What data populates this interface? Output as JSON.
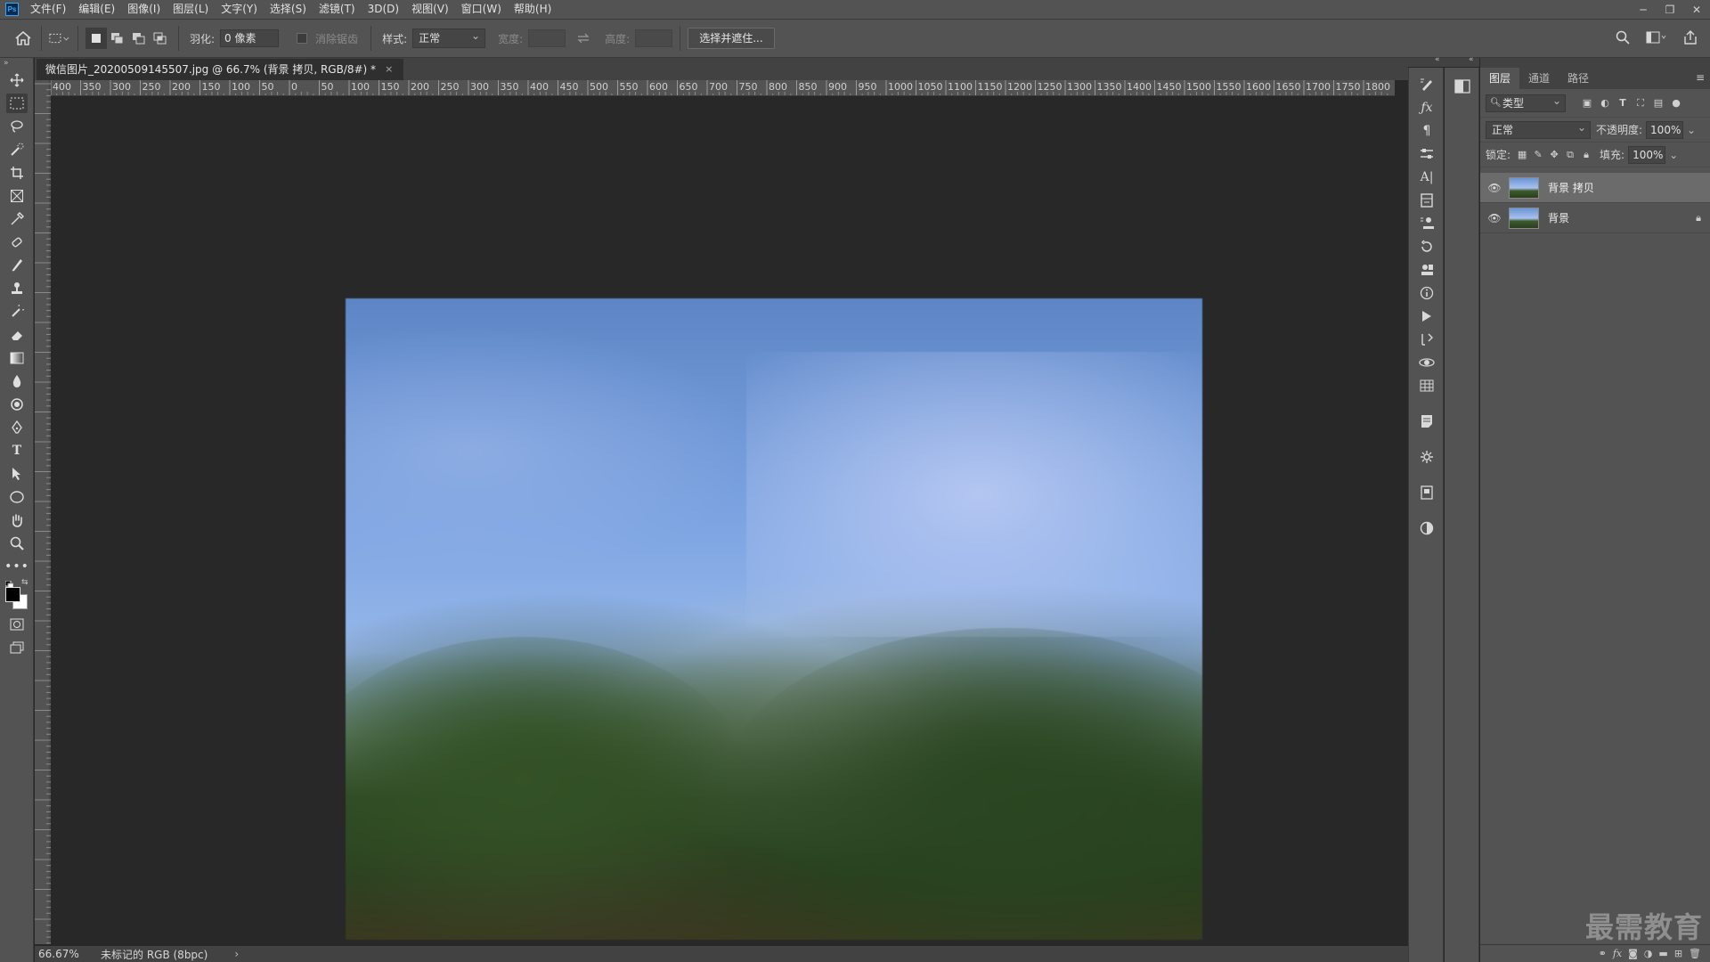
{
  "app": {
    "logo": "Ps"
  },
  "menu": [
    "文件(F)",
    "编辑(E)",
    "图像(I)",
    "图层(L)",
    "文字(Y)",
    "选择(S)",
    "滤镜(T)",
    "3D(D)",
    "视图(V)",
    "窗口(W)",
    "帮助(H)"
  ],
  "window_controls": {
    "minimize": "─",
    "restore": "❐",
    "close": "✕"
  },
  "options": {
    "feather_label": "羽化:",
    "feather_value": "0 像素",
    "antialias_label": "消除锯齿",
    "style_label": "样式:",
    "style_value": "正常",
    "width_label": "宽度:",
    "height_label": "高度:",
    "select_mask_button": "选择并遮住..."
  },
  "document": {
    "tab_title": "微信图片_20200509145507.jpg @ 66.7% (背景 拷贝, RGB/8#) *",
    "tab_close": "×",
    "ruler_labels": [
      "400",
      "350",
      "300",
      "250",
      "200",
      "150",
      "100",
      "50",
      "0",
      "50",
      "100",
      "150",
      "200",
      "250",
      "300",
      "350",
      "400",
      "450",
      "500",
      "550",
      "600",
      "650",
      "700",
      "750",
      "800",
      "850",
      "900",
      "950",
      "1000",
      "1050",
      "1100",
      "1150",
      "1200",
      "1250",
      "1300",
      "1350",
      "1400",
      "1450",
      "1500",
      "1550",
      "1600",
      "1650",
      "1700",
      "1750",
      "1800"
    ]
  },
  "status": {
    "zoom": "66.67%",
    "profile": "未标记的 RGB (8bpc)",
    "arrow": "›"
  },
  "panel": {
    "tabs": [
      "图层",
      "通道",
      "路径"
    ],
    "filter_kind": "类型",
    "blend_mode": "正常",
    "opacity_label": "不透明度:",
    "opacity_value": "100%",
    "lock_label": "锁定:",
    "fill_label": "填充:",
    "fill_value": "100%",
    "layers": [
      {
        "name": "背景 拷贝",
        "selected": true,
        "locked": false
      },
      {
        "name": "背景",
        "selected": false,
        "locked": true
      }
    ]
  },
  "watermark": "最需教育"
}
